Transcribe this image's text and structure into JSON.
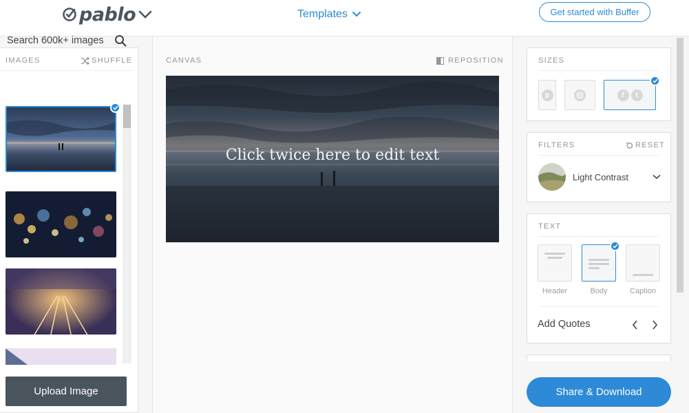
{
  "header": {
    "logo_text": "pablo",
    "templates_label": "Templates",
    "get_started_label": "Get started with Buffer"
  },
  "images_panel": {
    "title": "IMAGES",
    "shuffle_label": "SHUFFLE",
    "search_placeholder": "Search 600k+ images",
    "upload_label": "Upload Image"
  },
  "canvas": {
    "title": "CANVAS",
    "reposition_label": "REPOSITION",
    "overlay_text": "Click twice here to edit text"
  },
  "sizes": {
    "title": "SIZES",
    "options": [
      {
        "icon": "pinterest-icon",
        "selected": false
      },
      {
        "icon": "instagram-icon",
        "selected": false
      },
      {
        "icon": "facebook-twitter-icon",
        "selected": true
      }
    ]
  },
  "filters": {
    "title": "FILTERS",
    "reset_label": "RESET",
    "selected_filter": "Light Contrast"
  },
  "text_panel": {
    "title": "TEXT",
    "options": [
      {
        "label": "Header",
        "selected": false
      },
      {
        "label": "Body",
        "selected": true
      },
      {
        "label": "Caption",
        "selected": false
      }
    ],
    "quotes_label": "Add Quotes"
  },
  "share_label": "Share & Download",
  "colors": {
    "accent": "#2c8ad6",
    "upload_button": "#4a545d"
  }
}
